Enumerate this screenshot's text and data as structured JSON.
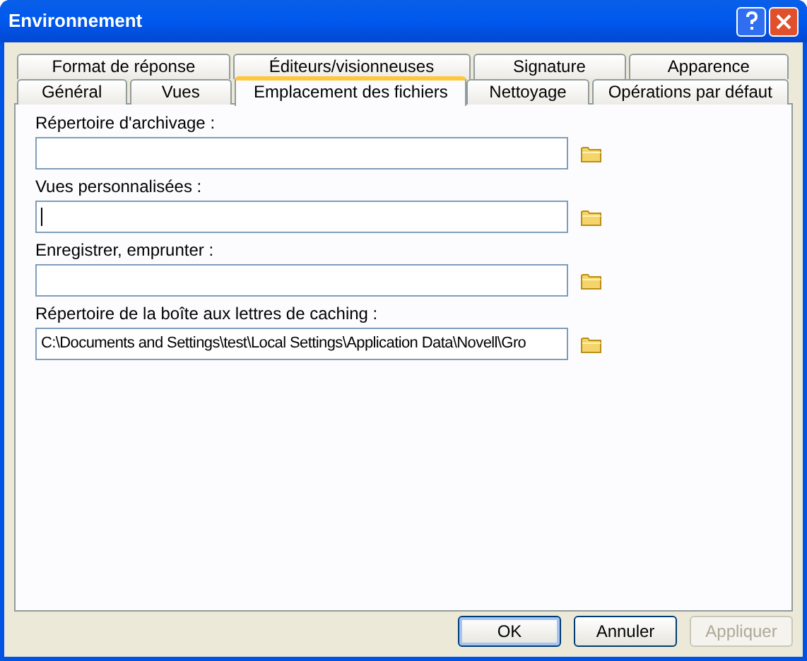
{
  "window": {
    "title": "Environnement"
  },
  "tab_rows": [
    [
      {
        "label": "Format de réponse",
        "selected": false
      },
      {
        "label": "Éditeurs/visionneuses",
        "selected": false
      },
      {
        "label": "Signature",
        "selected": false
      },
      {
        "label": "Apparence",
        "selected": false
      }
    ],
    [
      {
        "label": "Général",
        "selected": false
      },
      {
        "label": "Vues",
        "selected": false
      },
      {
        "label": "Emplacement des fichiers",
        "selected": true
      },
      {
        "label": "Nettoyage",
        "selected": false
      },
      {
        "label": "Opérations par défaut",
        "selected": false
      }
    ]
  ],
  "fields": [
    {
      "label": "Répertoire d'archivage :",
      "focused": false
    },
    {
      "label": "Vues personnalisées :",
      "focused": true
    },
    {
      "label": "Enregistrer, emprunter :",
      "focused": false
    },
    {
      "label": "Répertoire de la boîte aux lettres de caching :",
      "value": "C:\\Documents and Settings\\test\\Local Settings\\Application Data\\Novell\\Gro",
      "focused": false
    }
  ],
  "buttons": [
    {
      "label": "OK",
      "default": true,
      "disabled": false
    },
    {
      "label": "Annuler",
      "default": false,
      "disabled": false
    },
    {
      "label": "Appliquer",
      "default": false,
      "disabled": true
    }
  ]
}
